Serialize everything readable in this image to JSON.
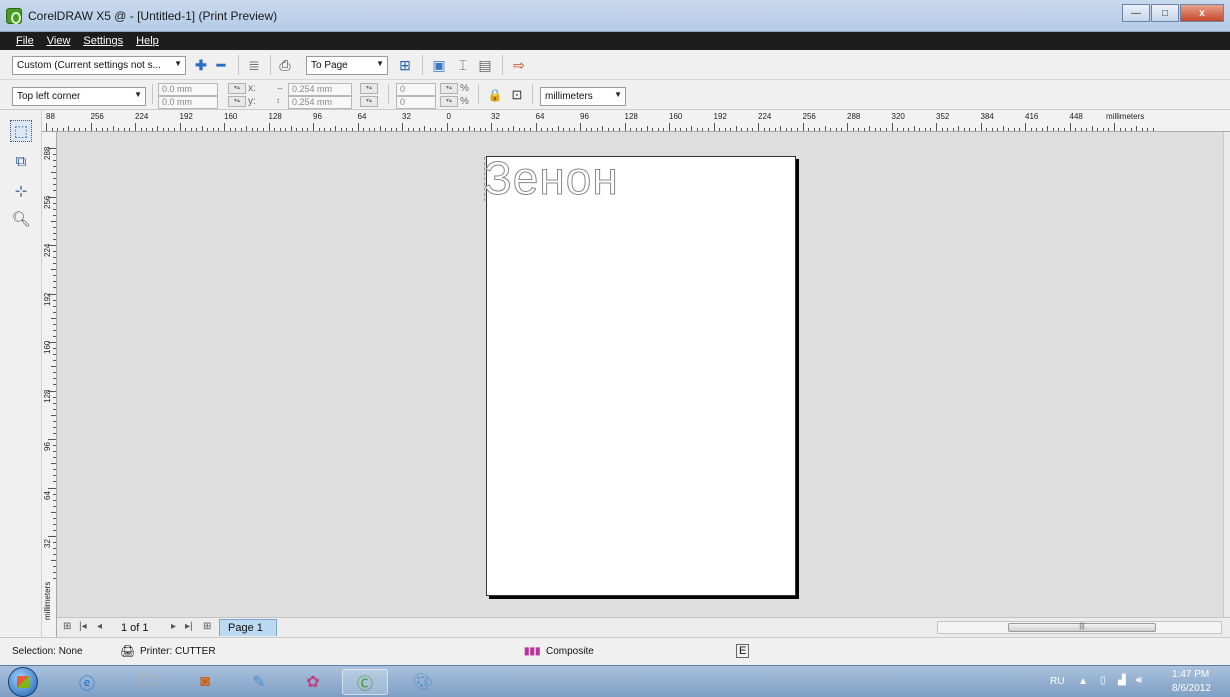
{
  "window": {
    "title": "CorelDRAW X5 @ - [Untitled-1] (Print Preview)",
    "minimize_glyph": "—",
    "maximize_glyph": "□",
    "close_glyph": "x"
  },
  "menu": {
    "items": [
      "File",
      "View",
      "Settings",
      "Help"
    ]
  },
  "toolbar1": {
    "print_style": "Custom (Current settings not s...",
    "zoom": "To Page",
    "icons": [
      "add-icon",
      "remove-icon",
      "print-options-icon",
      "print-icon",
      "zoom-icon",
      "full-screen-icon",
      "tile-icon",
      "separations-icon",
      "close-preview-icon"
    ]
  },
  "toolbar2": {
    "position": "Top left corner",
    "x_value": "0.0 mm",
    "y_value": "0.0 mm",
    "x_label": "x:",
    "y_label": "y:",
    "width_value": "0.254 mm",
    "height_value": "0.254 mm",
    "scale_x": "0",
    "scale_y": "0",
    "percent_label": "%",
    "units": "millimeters"
  },
  "ruler_top": {
    "labels": [
      "88",
      "256",
      "224",
      "192",
      "160",
      "128",
      "96",
      "64",
      "32",
      "0",
      "32",
      "64",
      "96",
      "128",
      "160",
      "192",
      "224",
      "256",
      "288",
      "320",
      "352",
      "384",
      "416",
      "448",
      "millimeters"
    ]
  },
  "ruler_left": {
    "labels": [
      "288",
      "256",
      "224",
      "192",
      "160",
      "128",
      "96",
      "64",
      "32",
      "millimeters"
    ]
  },
  "page": {
    "text": "Зенон"
  },
  "navigator": {
    "count": "1 of 1",
    "tab": "Page 1"
  },
  "status": {
    "selection": "Selection: None",
    "printer": "Printer: CUTTER",
    "mode": "Composite"
  },
  "taskbar": {
    "lang": "RU",
    "time": "1:47 PM",
    "date": "8/6/2012"
  },
  "colors": {
    "menubar": "#1d1d1d",
    "canvas": "#dedede",
    "page_tab": "#bcd9f2",
    "taskbar": "#8fabcf"
  }
}
